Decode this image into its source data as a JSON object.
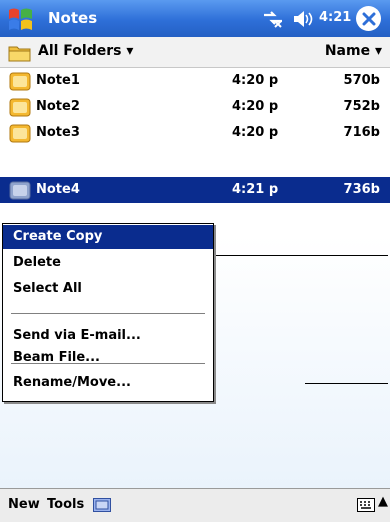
{
  "titlebar": {
    "title": "Notes",
    "time": "4:21",
    "colors": {
      "bar": "#2e6fd8",
      "close": "#2e6fd8"
    }
  },
  "folderbar": {
    "folder": "All Folders",
    "sort": "Name"
  },
  "list": {
    "rows": [
      {
        "name": "Note1",
        "time": "4:20 p",
        "size": "570b"
      },
      {
        "name": "Note2",
        "time": "4:20 p",
        "size": "752b"
      },
      {
        "name": "Note3",
        "time": "4:20 p",
        "size": "716b"
      },
      {
        "name": "Note4",
        "time": "4:21 p",
        "size": "736b"
      }
    ],
    "selected_index": 3
  },
  "context_menu": {
    "items": [
      {
        "label": "Create Copy"
      },
      {
        "label": "Delete"
      },
      {
        "label": "Select All"
      },
      {
        "label": "Send via E-mail..."
      },
      {
        "label": "Beam File..."
      },
      {
        "label": "Rename/Move..."
      }
    ],
    "highlight_color": "#0a2c8e"
  },
  "bottombar": {
    "new_label": "New",
    "tools_label": "Tools"
  },
  "icons": [
    "windows-start-icon",
    "connectivity-icon",
    "speaker-icon",
    "close-icon",
    "folder-icon",
    "note-icon",
    "recording-icon",
    "keyboard-icon",
    "up-arrow-icon"
  ]
}
